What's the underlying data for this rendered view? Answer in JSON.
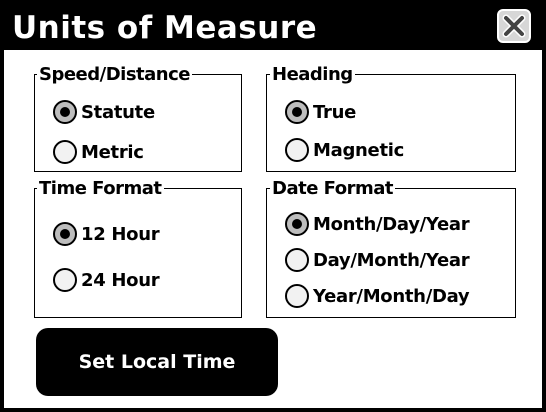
{
  "window": {
    "title": "Units of Measure"
  },
  "speed_distance": {
    "legend": "Speed/Distance",
    "options": [
      {
        "label": "Statute",
        "selected": true
      },
      {
        "label": "Metric",
        "selected": false
      }
    ]
  },
  "heading": {
    "legend": "Heading",
    "options": [
      {
        "label": "True",
        "selected": true
      },
      {
        "label": "Magnetic",
        "selected": false
      }
    ]
  },
  "time_format": {
    "legend": "Time Format",
    "options": [
      {
        "label": "12 Hour",
        "selected": true
      },
      {
        "label": "24 Hour",
        "selected": false
      }
    ]
  },
  "date_format": {
    "legend": "Date Format",
    "options": [
      {
        "label": "Month/Day/Year",
        "selected": true
      },
      {
        "label": "Day/Month/Year",
        "selected": false
      },
      {
        "label": "Year/Month/Day",
        "selected": false
      }
    ]
  },
  "buttons": {
    "set_local_time": "Set Local Time"
  },
  "icons": {
    "close": "close-icon"
  }
}
